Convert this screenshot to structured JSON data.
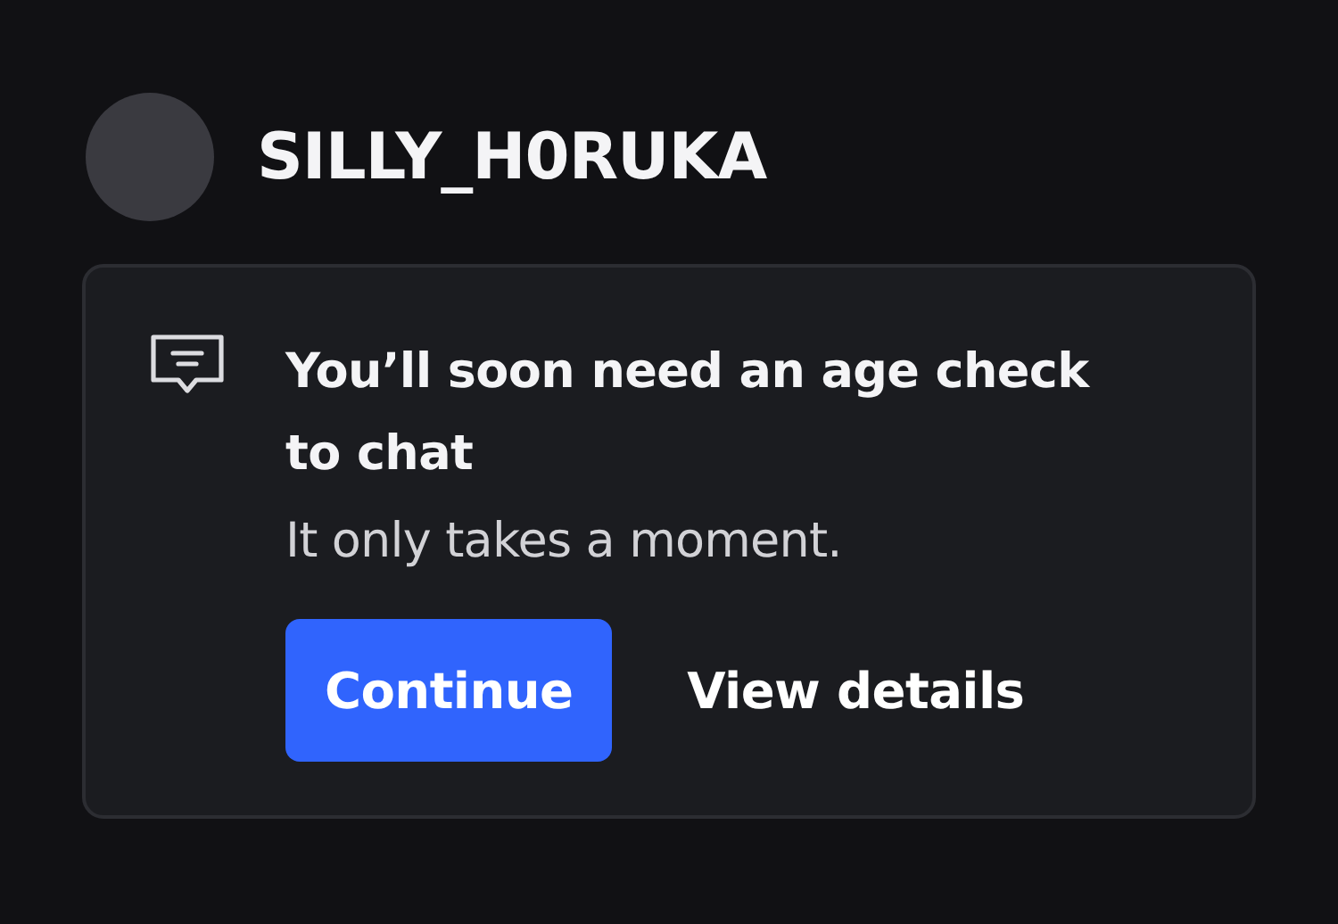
{
  "user": {
    "name": "SILLY_H0RUKA"
  },
  "notice": {
    "title": "You’ll soon need an age check to chat",
    "subtitle": "It only takes a moment.",
    "buttons": [
      {
        "label": "Continue",
        "kind": "primary"
      },
      {
        "label": "View details",
        "kind": "link"
      }
    ]
  }
}
